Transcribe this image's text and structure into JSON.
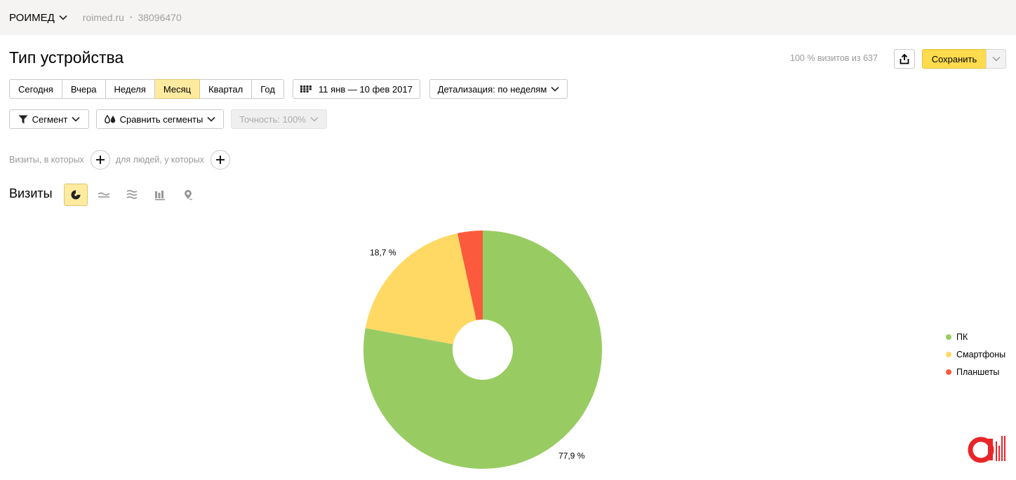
{
  "topbar": {
    "counter_name": "РОИМЕД",
    "site": "roimed.ru",
    "separator": "•",
    "counter_id": "38096470"
  },
  "page": {
    "title": "Тип устройства",
    "visits_share": "100 % визитов из 637",
    "save_label": "Сохранить"
  },
  "periods": [
    "Сегодня",
    "Вчера",
    "Неделя",
    "Месяц",
    "Квартал",
    "Год"
  ],
  "active_period": "Месяц",
  "date_range": "11 янв — 10 фев 2017",
  "detail_label": "Детализация: по неделям",
  "segment_label": "Сегмент",
  "compare_label": "Сравнить сегменты",
  "accuracy_label": "Точность: 100%",
  "filters": {
    "visits_where": "Визиты, в которых",
    "people_where": "для людей, у которых"
  },
  "metric_label": "Визиты",
  "chart_data": {
    "type": "pie",
    "donut": true,
    "categories": [
      "ПК",
      "Смартфоны",
      "Планшеты"
    ],
    "values": [
      77.9,
      18.7,
      3.4
    ],
    "colors": [
      "#98cc62",
      "#ffd964",
      "#fb5a3d"
    ],
    "data_labels": [
      "77,9 %",
      "18,7 %",
      ""
    ],
    "legend_position": "right"
  }
}
